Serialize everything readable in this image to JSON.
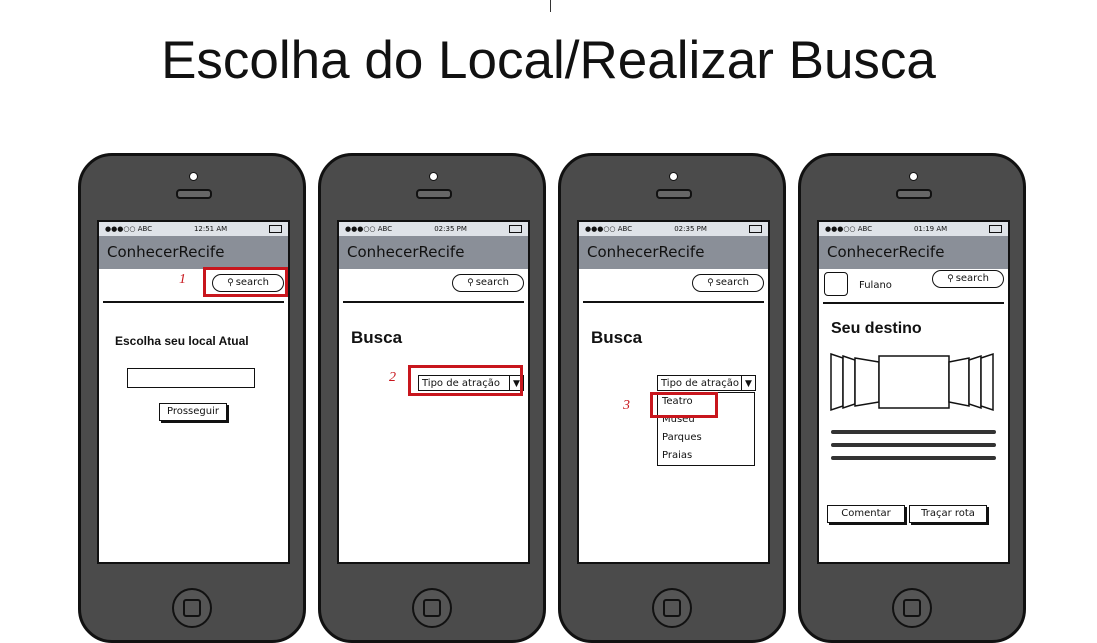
{
  "title": "Escolha do Local/Realizar Busca",
  "phones": [
    {
      "status": {
        "carrier": "●●●○○ ABC",
        "time": "12:51 AM"
      },
      "app_title": "ConhecerRecife",
      "search_placeholder": "search",
      "step_number": "1",
      "prompt": "Escolha seu local Atual",
      "button": "Prosseguir"
    },
    {
      "status": {
        "carrier": "●●●○○ ABC",
        "time": "02:35 PM"
      },
      "app_title": "ConhecerRecife",
      "search_placeholder": "search",
      "heading": "Busca",
      "step_number": "2",
      "select_label": "Tipo de atração"
    },
    {
      "status": {
        "carrier": "●●●○○ ABC",
        "time": "02:35 PM"
      },
      "app_title": "ConhecerRecife",
      "search_placeholder": "search",
      "heading": "Busca",
      "select_label": "Tipo de atração",
      "step_number": "3",
      "options": [
        "Teatro",
        "Museu",
        "Parques",
        "Praias"
      ]
    },
    {
      "status": {
        "carrier": "●●●○○ ABC",
        "time": "01:19 AM"
      },
      "app_title": "ConhecerRecife",
      "search_placeholder": "search",
      "user": "Fulano",
      "heading": "Seu destino",
      "buttons": [
        "Comentar",
        "Traçar rota"
      ]
    }
  ],
  "colors": {
    "highlight": "#c8161d",
    "appbar": "#8a8f98",
    "phone_body": "#4b4b4b"
  }
}
